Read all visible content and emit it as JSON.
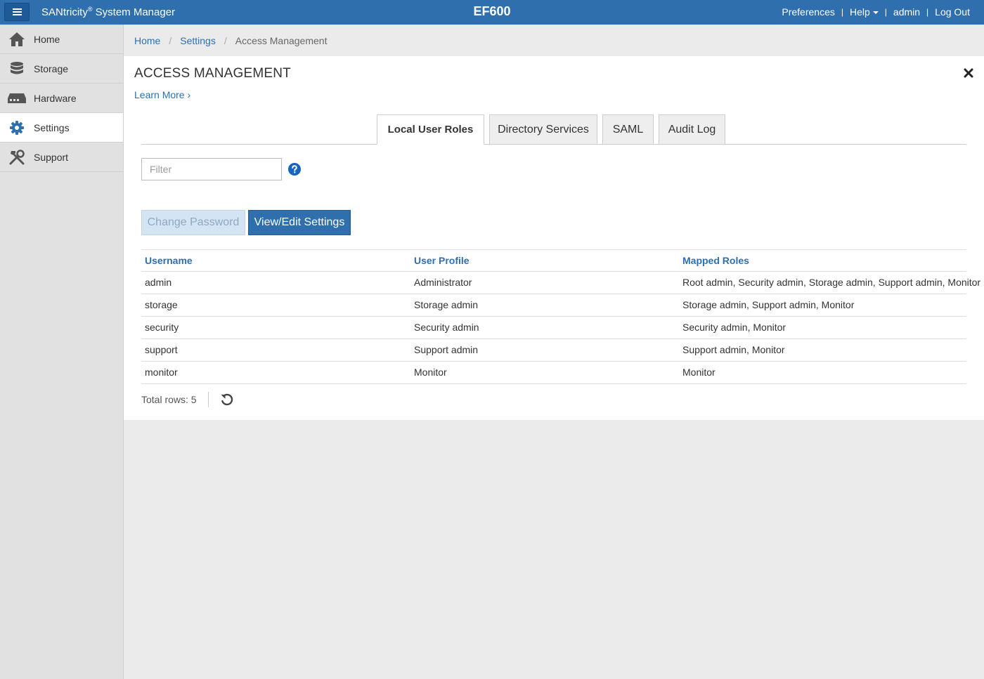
{
  "app": {
    "brand_name": "SANtricity",
    "brand_reg": "®",
    "brand_suffix": " System Manager",
    "system_name": "EF600"
  },
  "topnav": {
    "preferences": "Preferences",
    "help": "Help",
    "user": "admin",
    "logout": "Log Out",
    "separator": "|"
  },
  "sidebar": {
    "items": [
      {
        "label": "Home",
        "icon": "home-icon"
      },
      {
        "label": "Storage",
        "icon": "database-icon"
      },
      {
        "label": "Hardware",
        "icon": "hardware-icon"
      },
      {
        "label": "Settings",
        "icon": "gear-icon",
        "active": true
      },
      {
        "label": "Support",
        "icon": "tools-icon"
      }
    ]
  },
  "breadcrumb": {
    "items": [
      "Home",
      "Settings"
    ],
    "current": "Access Management",
    "separator": "/"
  },
  "page": {
    "title": "ACCESS MANAGEMENT",
    "learn_more": "Learn More ›"
  },
  "tabs": [
    {
      "label": "Local User Roles",
      "active": true
    },
    {
      "label": "Directory Services"
    },
    {
      "label": "SAML"
    },
    {
      "label": "Audit Log"
    }
  ],
  "filter": {
    "placeholder": "Filter",
    "value": ""
  },
  "buttons": {
    "change_password": "Change Password",
    "view_edit": "View/Edit Settings"
  },
  "table": {
    "headers": [
      "Username",
      "User Profile",
      "Mapped Roles"
    ],
    "rows": [
      [
        "admin",
        "Administrator",
        "Root admin, Security admin, Storage admin, Support admin, Monitor"
      ],
      [
        "storage",
        "Storage admin",
        "Storage admin, Support admin, Monitor"
      ],
      [
        "security",
        "Security admin",
        "Security admin, Monitor"
      ],
      [
        "support",
        "Support admin",
        "Support admin, Monitor"
      ],
      [
        "monitor",
        "Monitor",
        "Monitor"
      ]
    ]
  },
  "footer": {
    "total_rows": "Total rows: 5"
  },
  "colors": {
    "header_bg": "#2f6fae",
    "link": "#2f6fae",
    "primary_button": "#2f6fae",
    "disabled_button": "#d3e5f3",
    "sidebar_bg": "#e1e1e1",
    "help_icon": "#1565c0"
  }
}
